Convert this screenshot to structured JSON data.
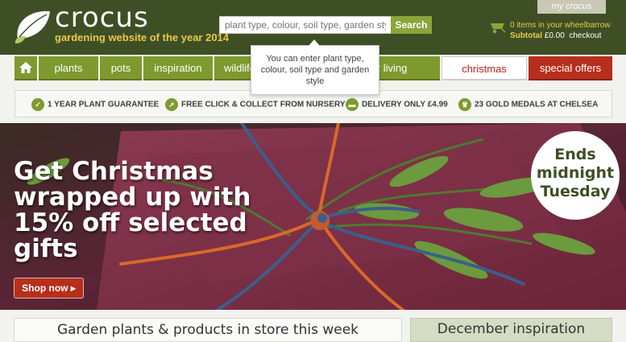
{
  "header": {
    "logo_text": "crocus",
    "tagline": "gardening website of the year 2014",
    "search_placeholder": "plant type, colour, soil type, garden style",
    "search_button": "Search",
    "my_crocus": "my crocus",
    "cart_items": "0 items in your wheelbarrow",
    "cart_subtotal_label": "Subtotal",
    "cart_subtotal_value": "£0.00",
    "checkout": "checkout"
  },
  "tooltip": {
    "text": "You can enter plant type, colour, soil type and garden style"
  },
  "nav": {
    "home_icon": "home-icon",
    "items": [
      {
        "label": "plants"
      },
      {
        "label": "pots"
      },
      {
        "label": "inspiration"
      },
      {
        "label": "wildlife"
      },
      {
        "label": "outdoor living"
      },
      {
        "label": "christmas"
      },
      {
        "label": "special offers"
      }
    ]
  },
  "usp": [
    {
      "icon": "tick-icon",
      "label": "1 YEAR PLANT GUARANTEE"
    },
    {
      "icon": "cursor-icon",
      "label": "FREE CLICK & COLLECT FROM NURSERY"
    },
    {
      "icon": "van-icon",
      "label": "DELIVERY ONLY £4.99"
    },
    {
      "icon": "trophy-icon",
      "label": "23 GOLD MEDALS AT CHELSEA"
    }
  ],
  "hero": {
    "headline": "Get Christmas wrapped up with 15% off selected gifts",
    "button": "Shop now ▸",
    "badge": "Ends midnight Tuesday"
  },
  "bottom": {
    "left_title": "Garden plants & products in store this week",
    "right_title": "December inspiration"
  },
  "colors": {
    "header_bg": "#3e4f25",
    "nav_green": "#7e9a2e",
    "accent_gold": "#e8c94a",
    "offers_red": "#b62f1c"
  }
}
